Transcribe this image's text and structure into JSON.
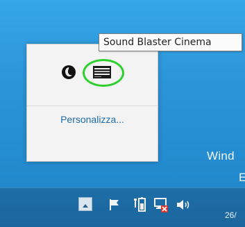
{
  "tooltip": {
    "text": "Sound Blaster Cinema"
  },
  "flyout": {
    "personalize_label": "Personalizza...",
    "icons": [
      "creative-icon",
      "sound-blaster-cinema-icon"
    ],
    "highlight_color": "#2bd02b"
  },
  "desktop": {
    "watermark_line1": "Wind",
    "watermark_line2": "E"
  },
  "taskbar": {
    "tray_icons": [
      "chevron-up-icon",
      "flag-icon",
      "power-icon",
      "network-icon",
      "speaker-icon"
    ],
    "clock_text": "26/"
  },
  "colors": {
    "desktop": "#2b94d8",
    "taskbar": "#1e6ea8",
    "link": "#1e6aa8",
    "error_badge": "#d9342b"
  }
}
